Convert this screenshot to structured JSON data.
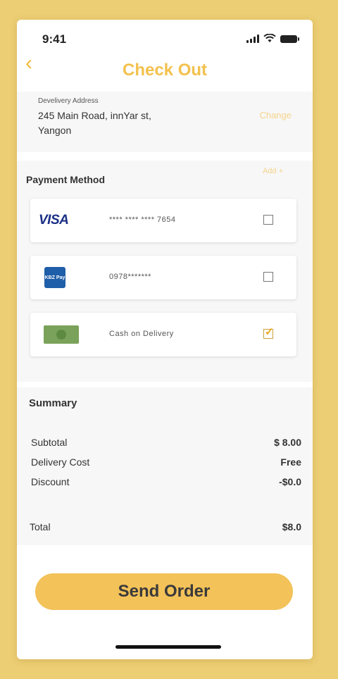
{
  "status": {
    "time": "9:41"
  },
  "header": {
    "title": "Check Out",
    "back_icon": "chevron-left-icon"
  },
  "address": {
    "label": "Develivery Address",
    "line1": "245 Main Road, innYar st,",
    "line2": "Yangon",
    "change_label": "Change"
  },
  "payment": {
    "title": "Payment Method",
    "add_label": "Add +",
    "methods": [
      {
        "logo": "VISA",
        "number": "****  ****  ****  7654",
        "checked": false
      },
      {
        "logo": "KBZ Pay",
        "number": "0978*******",
        "checked": false
      },
      {
        "logo": "cash-icon",
        "number": "Cash on Delivery",
        "checked": true
      }
    ]
  },
  "summary": {
    "title": "Summary",
    "rows": [
      {
        "label": "Subtotal",
        "value": "$ 8.00"
      },
      {
        "label": "Delivery Cost",
        "value": "Free"
      },
      {
        "label": "Discount",
        "value": "-$0.0"
      }
    ],
    "total_label": "Total",
    "total_value": "$8.0"
  },
  "actions": {
    "send_order_label": "Send Order"
  },
  "colors": {
    "accent": "#f3c259",
    "background": "#ecce74",
    "title": "#f3c14d"
  }
}
